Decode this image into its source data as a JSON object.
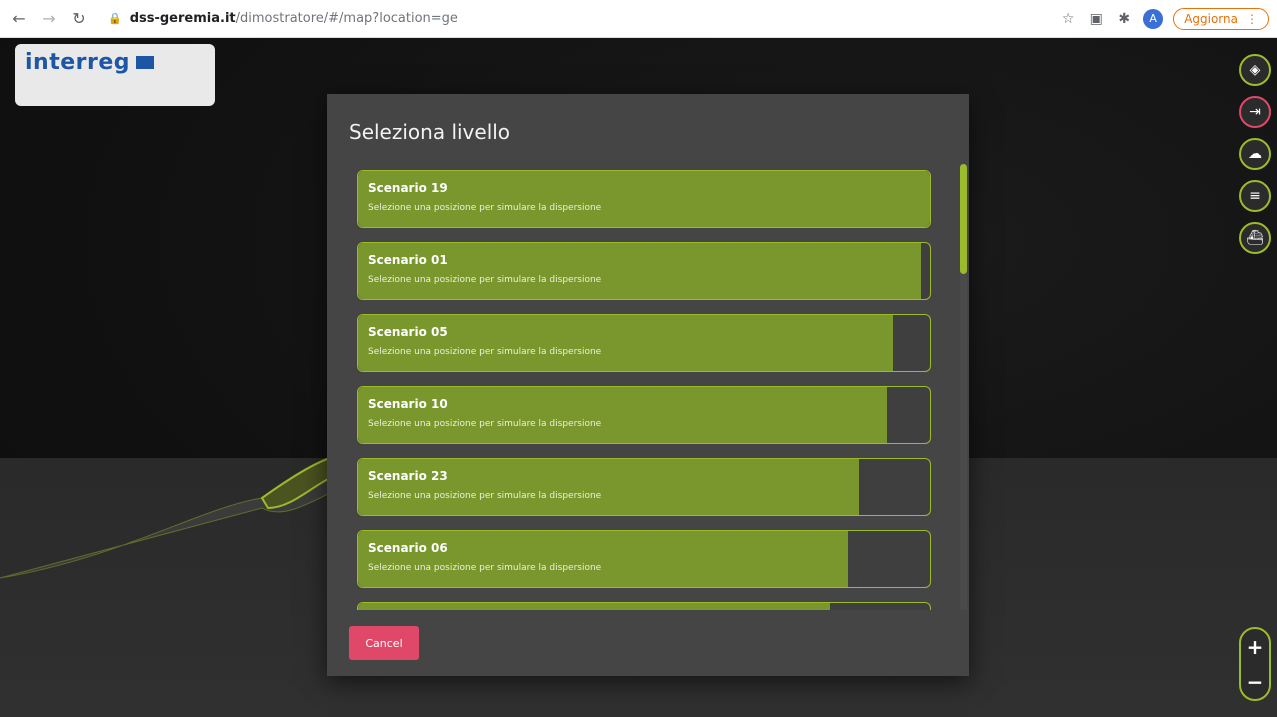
{
  "browser": {
    "url_host": "dss-geremia.it",
    "url_rest": "/dimostratore/#/map?location=ge",
    "avatar_letter": "A",
    "update_label": "Aggiorna"
  },
  "logo": {
    "brand": "interreg"
  },
  "modal": {
    "title": "Seleziona livello",
    "cancel_label": "Cancel",
    "items": [
      {
        "title": "Scenario 19",
        "subtitle": "Selezione una posizione per simulare la dispersione",
        "progress": 1.0
      },
      {
        "title": "Scenario 01",
        "subtitle": "Selezione una posizione per simulare la dispersione",
        "progress": 0.985
      },
      {
        "title": "Scenario 05",
        "subtitle": "Selezione una posizione per simulare la dispersione",
        "progress": 0.935
      },
      {
        "title": "Scenario 10",
        "subtitle": "Selezione una posizione per simulare la dispersione",
        "progress": 0.925
      },
      {
        "title": "Scenario 23",
        "subtitle": "Selezione una posizione per simulare la dispersione",
        "progress": 0.875
      },
      {
        "title": "Scenario 06",
        "subtitle": "Selezione una posizione per simulare la dispersione",
        "progress": 0.857
      },
      {
        "title": "",
        "subtitle": "",
        "progress": 0.825
      }
    ]
  },
  "tools": [
    {
      "name": "layers-icon",
      "glyph": "◈"
    },
    {
      "name": "logout-icon",
      "glyph": "⇥"
    },
    {
      "name": "weather-icon",
      "glyph": "☁"
    },
    {
      "name": "drop-list-icon",
      "glyph": "≡"
    },
    {
      "name": "vessel-icon",
      "glyph": "⛴"
    }
  ],
  "zoom": {
    "in": "+",
    "out": "−"
  },
  "colors": {
    "accent_green": "#9cbb2a",
    "item_fill": "#7a972d",
    "cancel_red": "#e0486a",
    "modal_bg": "#454545"
  }
}
